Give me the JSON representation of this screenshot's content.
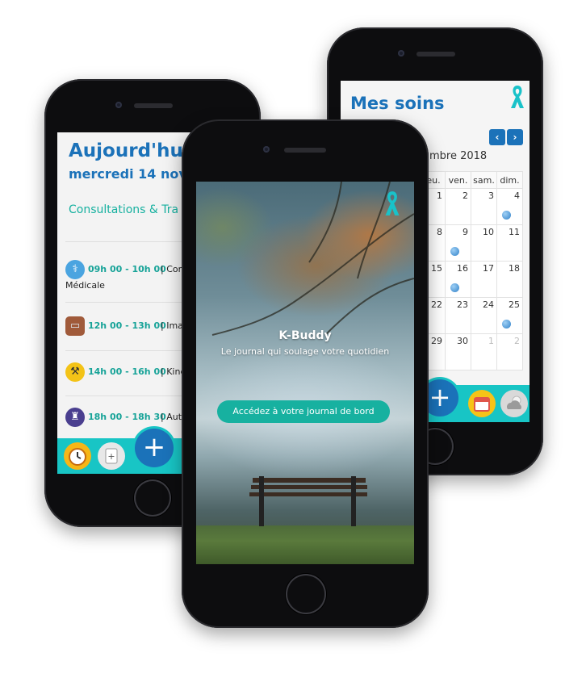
{
  "left_screen": {
    "title": "Aujourd'hui,",
    "date": "mercredi 14 nov",
    "section": "Consultations & Tra",
    "appointments": [
      {
        "time": "09h 00 - 10h 00",
        "sep": " | ",
        "label": "Cons",
        "line2": "Médicale",
        "icon": "stethoscope-icon"
      },
      {
        "time": "12h 00 - 13h 00",
        "sep": " | ",
        "label": "Imag",
        "icon": "monitor-icon"
      },
      {
        "time": "14h 00 - 16h 00",
        "sep": " | ",
        "label": "Kinés",
        "icon": "dumbbell-icon"
      },
      {
        "time": "18h 00 - 18h 30",
        "sep": " | ",
        "label": "Autre",
        "icon": "lighthouse-icon"
      }
    ],
    "bottom_bar": {
      "add": "+"
    }
  },
  "center_screen": {
    "app_name": "K-Buddy",
    "tagline": "Le journal qui soulage votre quotidien",
    "cta": "Accédez à votre journal de bord"
  },
  "right_screen": {
    "title": "Mes soins",
    "nav_prev": "‹",
    "nav_next": "›",
    "month": "mbre 2018",
    "weekdays": [
      "jeu.",
      "ven.",
      "sam.",
      "dim."
    ],
    "weeks": [
      [
        "1",
        "2",
        "3",
        "4"
      ],
      [
        "8",
        "9",
        "10",
        "11"
      ],
      [
        "15",
        "16",
        "17",
        "18"
      ],
      [
        "22",
        "23",
        "24",
        "25"
      ],
      [
        "29",
        "30",
        "1",
        "2"
      ]
    ],
    "bottom_bar": {
      "add": "+"
    }
  },
  "colors": {
    "brand_blue": "#1b72b9",
    "teal": "#17b1a0",
    "bar": "#18c5c5"
  }
}
